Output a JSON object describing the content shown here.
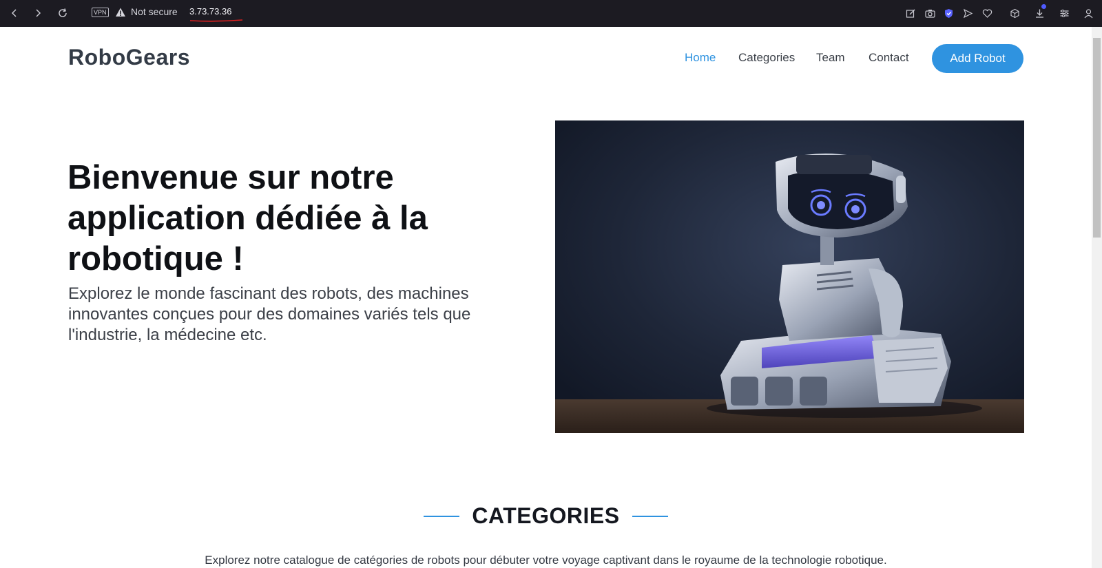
{
  "browser": {
    "vpn_label": "VPN",
    "security_text": "Not secure",
    "url": "3.73.73.36",
    "icons": [
      "back-icon",
      "forward-icon",
      "reload-icon",
      "warning-icon",
      "edit-icon",
      "camera-icon",
      "shield-icon",
      "send-icon",
      "heart-icon",
      "box-icon",
      "download-icon",
      "settings-icon",
      "user-icon"
    ]
  },
  "header": {
    "brand": "RoboGears",
    "nav": [
      {
        "label": "Home",
        "active": true
      },
      {
        "label": "Categories",
        "active": false
      },
      {
        "label": "Team",
        "active": false
      },
      {
        "label": "Contact",
        "active": false
      }
    ],
    "cta_label": "Add Robot"
  },
  "hero": {
    "title": "Bienvenue sur notre application dédiée à la robotique !",
    "subtitle": "Explorez le monde fascinant des robots, des machines innovantes conçues pour des domaines variés tels que l'industrie, la médecine etc."
  },
  "categories_section": {
    "title": "CATEGORIES",
    "description": "Explorez notre catalogue de catégories de robots pour débuter votre voyage captivant dans le royaume de la technologie robotique."
  },
  "colors": {
    "accent": "#2f93e0",
    "browser_bar": "#1c1b22"
  }
}
